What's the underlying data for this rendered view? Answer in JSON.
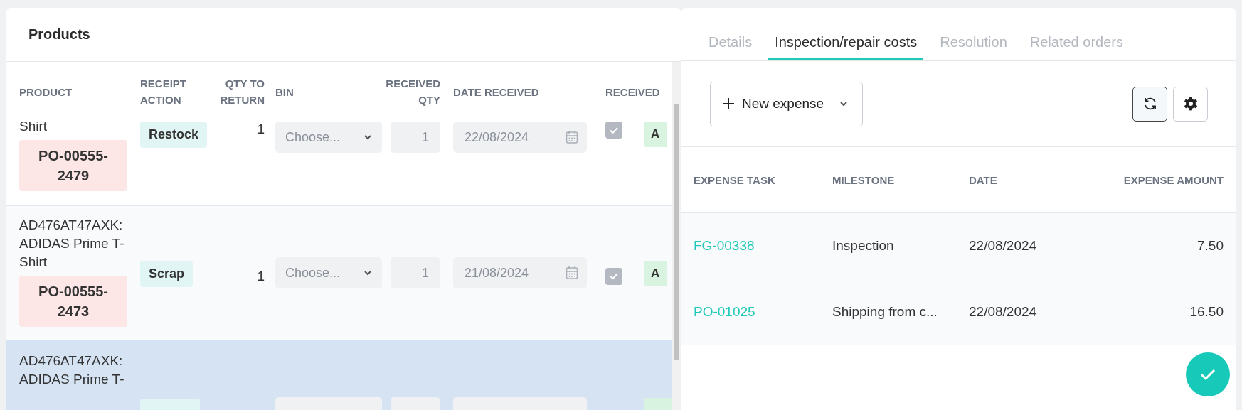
{
  "products": {
    "title": "Products",
    "columns": [
      "PRODUCT",
      "RECEIPT ACTION",
      "QTY TO RETURN",
      "BIN",
      "RECEIVED QTY",
      "DATE RECEIVED",
      "RECEIVED"
    ],
    "rows": [
      {
        "product": "Shirt",
        "order": "PO-00555-2479",
        "action": "Restock",
        "qty_to_return": "1",
        "bin_placeholder": "Choose...",
        "received_qty": "1",
        "date": "22/08/2024",
        "received": true,
        "status": "A",
        "selected": false
      },
      {
        "product": "AD476AT47AXK: ADIDAS Prime T-Shirt",
        "order": "PO-00555-2473",
        "action": "Scrap",
        "qty_to_return": "1",
        "bin_placeholder": "Choose...",
        "received_qty": "1",
        "date": "21/08/2024",
        "received": true,
        "status": "A",
        "selected": false
      },
      {
        "product": "AD476AT47AXK: ADIDAS Prime T-",
        "selected": true
      }
    ]
  },
  "detail": {
    "tabs": [
      {
        "label": "Details",
        "selected": false
      },
      {
        "label": "Inspection/repair costs",
        "selected": true
      },
      {
        "label": "Resolution",
        "selected": false
      },
      {
        "label": "Related orders",
        "selected": false
      }
    ],
    "new_button": {
      "label": "New expense"
    },
    "tools": [
      {
        "kind": "refresh",
        "pressed": true
      },
      {
        "kind": "settings",
        "pressed": false
      }
    ],
    "columns": [
      "EXPENSE TASK",
      "MILESTONE",
      "DATE",
      "EXPENSE AMOUNT"
    ],
    "rows": [
      {
        "task": "FG-00338",
        "milestone": "Inspection",
        "date": "22/08/2024",
        "amount": "7.50"
      },
      {
        "task": "PO-01025",
        "milestone": "Shipping from c...",
        "date": "22/08/2024",
        "amount": "16.50"
      }
    ]
  }
}
